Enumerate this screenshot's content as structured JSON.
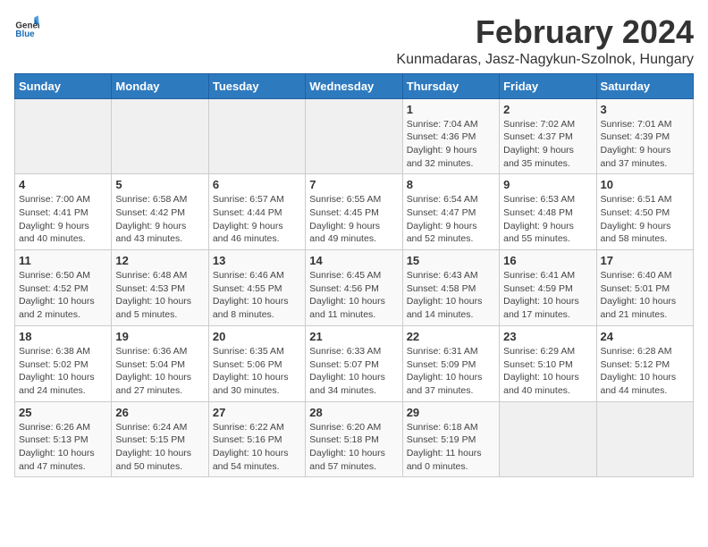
{
  "logo": {
    "text_general": "General",
    "text_blue": "Blue"
  },
  "title": "February 2024",
  "subtitle": "Kunmadaras, Jasz-Nagykun-Szolnok, Hungary",
  "days_of_week": [
    "Sunday",
    "Monday",
    "Tuesday",
    "Wednesday",
    "Thursday",
    "Friday",
    "Saturday"
  ],
  "weeks": [
    [
      {
        "day": "",
        "detail": ""
      },
      {
        "day": "",
        "detail": ""
      },
      {
        "day": "",
        "detail": ""
      },
      {
        "day": "",
        "detail": ""
      },
      {
        "day": "1",
        "detail": "Sunrise: 7:04 AM\nSunset: 4:36 PM\nDaylight: 9 hours\nand 32 minutes."
      },
      {
        "day": "2",
        "detail": "Sunrise: 7:02 AM\nSunset: 4:37 PM\nDaylight: 9 hours\nand 35 minutes."
      },
      {
        "day": "3",
        "detail": "Sunrise: 7:01 AM\nSunset: 4:39 PM\nDaylight: 9 hours\nand 37 minutes."
      }
    ],
    [
      {
        "day": "4",
        "detail": "Sunrise: 7:00 AM\nSunset: 4:41 PM\nDaylight: 9 hours\nand 40 minutes."
      },
      {
        "day": "5",
        "detail": "Sunrise: 6:58 AM\nSunset: 4:42 PM\nDaylight: 9 hours\nand 43 minutes."
      },
      {
        "day": "6",
        "detail": "Sunrise: 6:57 AM\nSunset: 4:44 PM\nDaylight: 9 hours\nand 46 minutes."
      },
      {
        "day": "7",
        "detail": "Sunrise: 6:55 AM\nSunset: 4:45 PM\nDaylight: 9 hours\nand 49 minutes."
      },
      {
        "day": "8",
        "detail": "Sunrise: 6:54 AM\nSunset: 4:47 PM\nDaylight: 9 hours\nand 52 minutes."
      },
      {
        "day": "9",
        "detail": "Sunrise: 6:53 AM\nSunset: 4:48 PM\nDaylight: 9 hours\nand 55 minutes."
      },
      {
        "day": "10",
        "detail": "Sunrise: 6:51 AM\nSunset: 4:50 PM\nDaylight: 9 hours\nand 58 minutes."
      }
    ],
    [
      {
        "day": "11",
        "detail": "Sunrise: 6:50 AM\nSunset: 4:52 PM\nDaylight: 10 hours\nand 2 minutes."
      },
      {
        "day": "12",
        "detail": "Sunrise: 6:48 AM\nSunset: 4:53 PM\nDaylight: 10 hours\nand 5 minutes."
      },
      {
        "day": "13",
        "detail": "Sunrise: 6:46 AM\nSunset: 4:55 PM\nDaylight: 10 hours\nand 8 minutes."
      },
      {
        "day": "14",
        "detail": "Sunrise: 6:45 AM\nSunset: 4:56 PM\nDaylight: 10 hours\nand 11 minutes."
      },
      {
        "day": "15",
        "detail": "Sunrise: 6:43 AM\nSunset: 4:58 PM\nDaylight: 10 hours\nand 14 minutes."
      },
      {
        "day": "16",
        "detail": "Sunrise: 6:41 AM\nSunset: 4:59 PM\nDaylight: 10 hours\nand 17 minutes."
      },
      {
        "day": "17",
        "detail": "Sunrise: 6:40 AM\nSunset: 5:01 PM\nDaylight: 10 hours\nand 21 minutes."
      }
    ],
    [
      {
        "day": "18",
        "detail": "Sunrise: 6:38 AM\nSunset: 5:02 PM\nDaylight: 10 hours\nand 24 minutes."
      },
      {
        "day": "19",
        "detail": "Sunrise: 6:36 AM\nSunset: 5:04 PM\nDaylight: 10 hours\nand 27 minutes."
      },
      {
        "day": "20",
        "detail": "Sunrise: 6:35 AM\nSunset: 5:06 PM\nDaylight: 10 hours\nand 30 minutes."
      },
      {
        "day": "21",
        "detail": "Sunrise: 6:33 AM\nSunset: 5:07 PM\nDaylight: 10 hours\nand 34 minutes."
      },
      {
        "day": "22",
        "detail": "Sunrise: 6:31 AM\nSunset: 5:09 PM\nDaylight: 10 hours\nand 37 minutes."
      },
      {
        "day": "23",
        "detail": "Sunrise: 6:29 AM\nSunset: 5:10 PM\nDaylight: 10 hours\nand 40 minutes."
      },
      {
        "day": "24",
        "detail": "Sunrise: 6:28 AM\nSunset: 5:12 PM\nDaylight: 10 hours\nand 44 minutes."
      }
    ],
    [
      {
        "day": "25",
        "detail": "Sunrise: 6:26 AM\nSunset: 5:13 PM\nDaylight: 10 hours\nand 47 minutes."
      },
      {
        "day": "26",
        "detail": "Sunrise: 6:24 AM\nSunset: 5:15 PM\nDaylight: 10 hours\nand 50 minutes."
      },
      {
        "day": "27",
        "detail": "Sunrise: 6:22 AM\nSunset: 5:16 PM\nDaylight: 10 hours\nand 54 minutes."
      },
      {
        "day": "28",
        "detail": "Sunrise: 6:20 AM\nSunset: 5:18 PM\nDaylight: 10 hours\nand 57 minutes."
      },
      {
        "day": "29",
        "detail": "Sunrise: 6:18 AM\nSunset: 5:19 PM\nDaylight: 11 hours\nand 0 minutes."
      },
      {
        "day": "",
        "detail": ""
      },
      {
        "day": "",
        "detail": ""
      }
    ]
  ]
}
